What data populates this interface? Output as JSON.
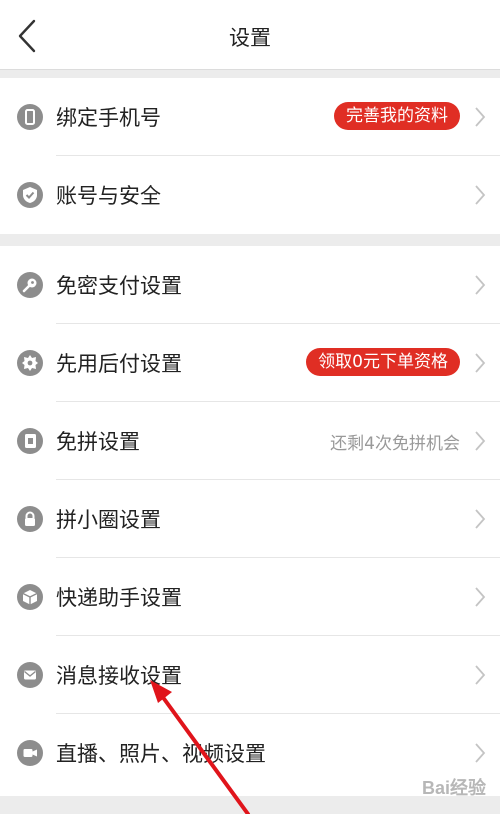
{
  "header": {
    "title": "设置",
    "back_icon": "chevron-left-icon"
  },
  "groups": [
    {
      "items": [
        {
          "label": "绑定手机号",
          "icon": "phone-icon",
          "badge": "完善我的资料"
        },
        {
          "label": "账号与安全",
          "icon": "shield-icon"
        }
      ]
    },
    {
      "items": [
        {
          "label": "免密支付设置",
          "icon": "key-icon"
        },
        {
          "label": "先用后付设置",
          "icon": "seal-icon",
          "badge": "领取0元下单资格"
        },
        {
          "label": "免拼设置",
          "icon": "card-icon",
          "note": "还剩4次免拼机会"
        },
        {
          "label": "拼小圈设置",
          "icon": "lock-icon"
        },
        {
          "label": "快递助手设置",
          "icon": "package-icon"
        },
        {
          "label": "消息接收设置",
          "icon": "mail-icon"
        },
        {
          "label": "直播、照片、视频设置",
          "icon": "video-icon"
        }
      ]
    }
  ],
  "colors": {
    "badge": "#e02e24",
    "arrow": "#e0141b",
    "icon_gray": "#8d8d8d"
  },
  "watermark": "Bai经验"
}
